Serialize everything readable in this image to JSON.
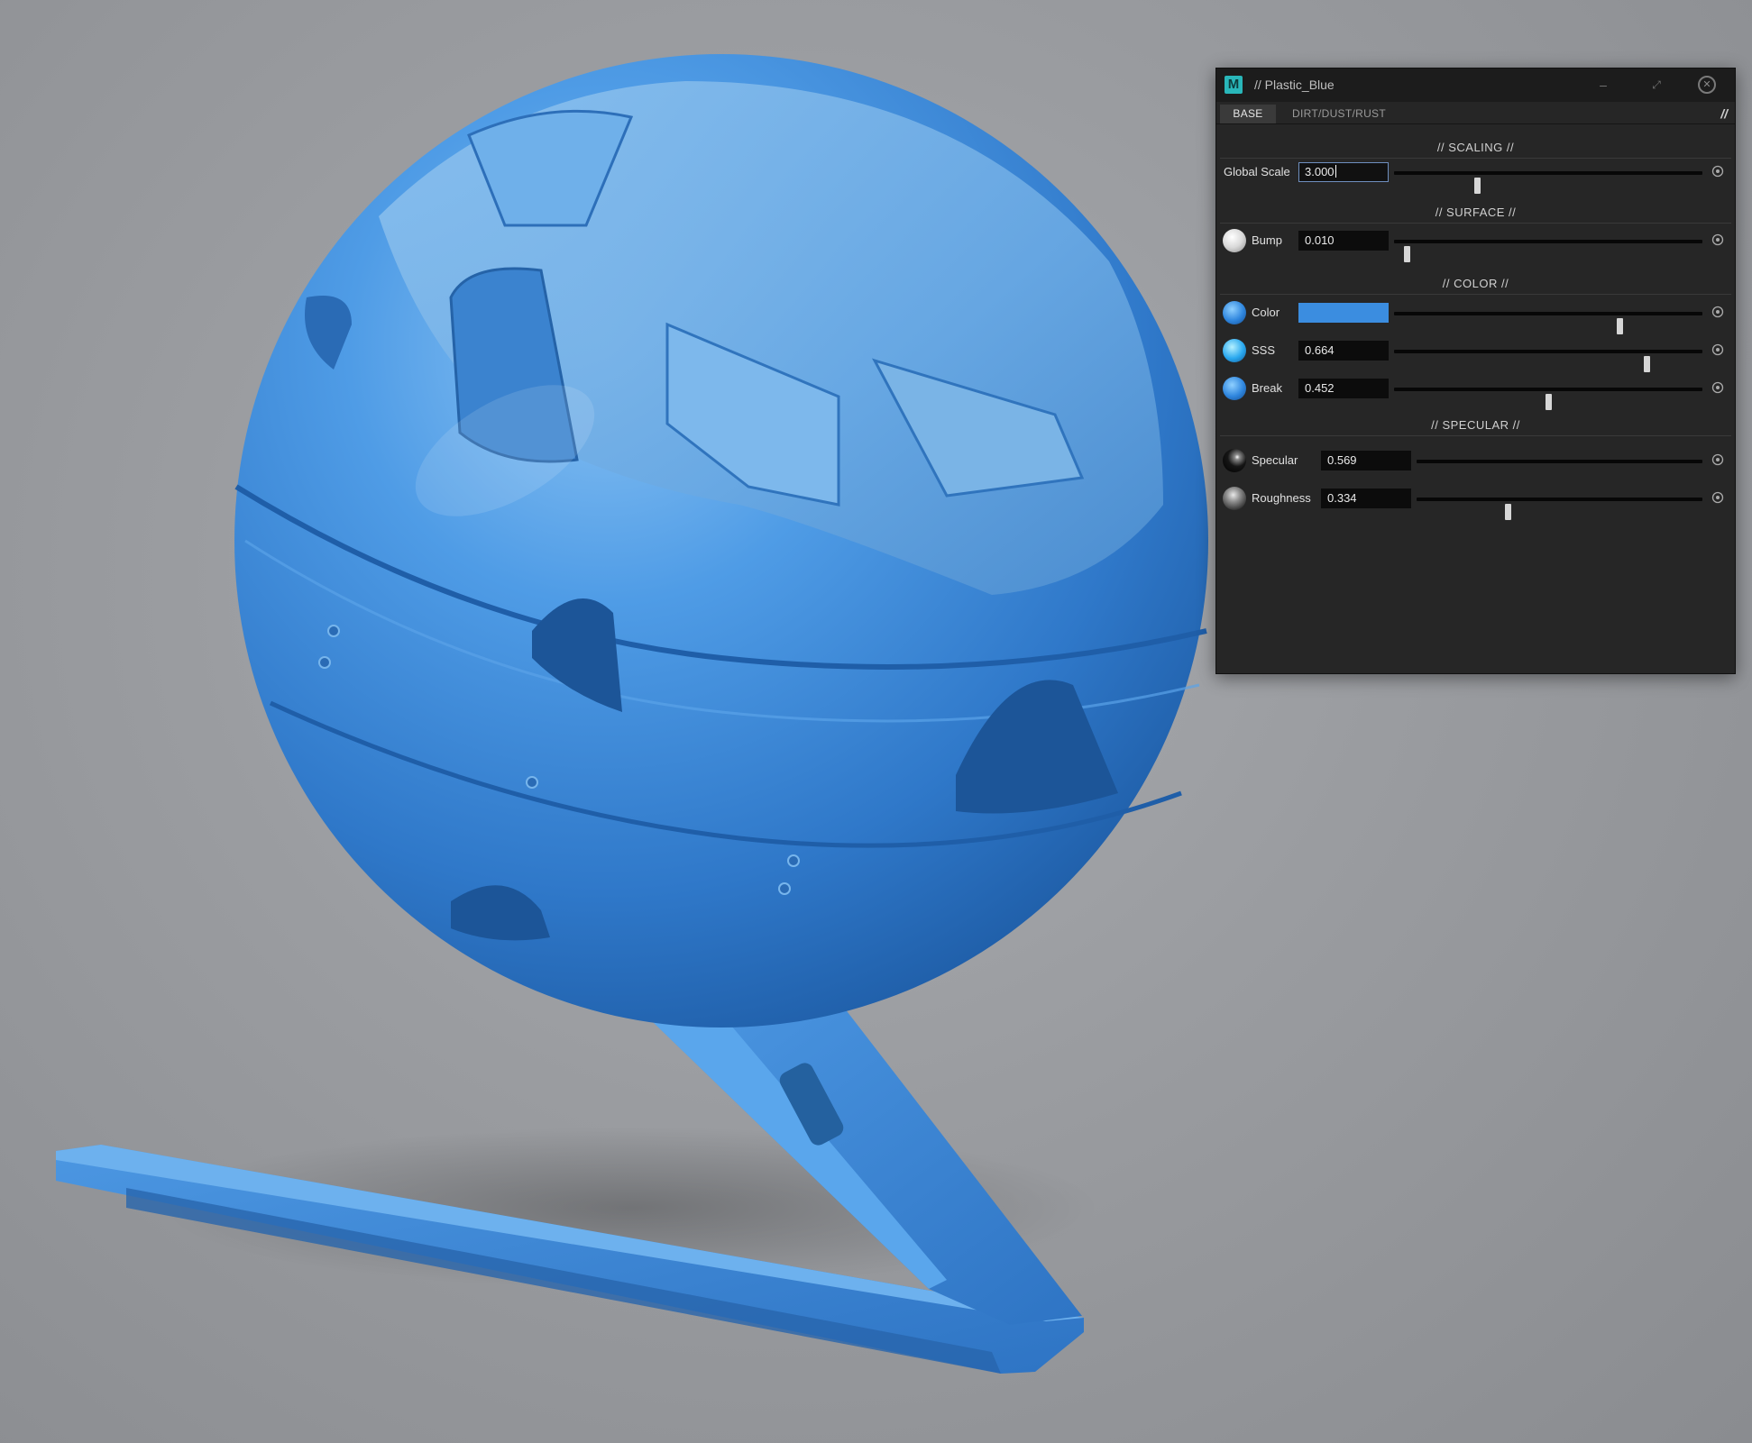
{
  "window": {
    "title": "// Plastic_Blue",
    "logo_letter": "M",
    "minimize_glyph": "–",
    "maximize_glyph": "⤢",
    "close_glyph": "✕"
  },
  "tabs": [
    {
      "label": "BASE",
      "active": true
    },
    {
      "label": "DIRT/DUST/RUST",
      "active": false
    }
  ],
  "tab_extra_glyph": "//",
  "sections": {
    "scaling": "// SCALING //",
    "surface": "// SURFACE //",
    "color": "// COLOR //",
    "specular": "// SPECULAR //"
  },
  "params": {
    "global_scale": {
      "label": "Global Scale",
      "value": "3.000",
      "slider": 0.27
    },
    "bump": {
      "label": "Bump",
      "value": "0.010",
      "slider": 0.04
    },
    "color": {
      "label": "Color",
      "value": "",
      "swatch_hex": "#3b8de0",
      "slider": 0.73
    },
    "sss": {
      "label": "SSS",
      "value": "0.664",
      "slider": 0.82
    },
    "break": {
      "label": "Break",
      "value": "0.452",
      "slider": 0.5
    },
    "specular": {
      "label": "Specular",
      "value": "0.569",
      "slider": 0.0
    },
    "roughness": {
      "label": "Roughness",
      "value": "0.334",
      "slider": 0.32
    }
  },
  "icons": {
    "reset": "reset-target-icon",
    "bump_swatch": "white-sphere-icon",
    "color_swatch": "blue-sphere-icon",
    "sss_swatch": "cyan-sphere-icon",
    "break_swatch": "blue-sphere-icon",
    "specular_swatch": "dark-sphere-icon",
    "roughness_swatch": "grey-sphere-icon"
  },
  "colors": {
    "accent": "#3b8de0",
    "panel_bg": "#262626",
    "logo": "#29b6b9",
    "material": "#3a86d6"
  }
}
